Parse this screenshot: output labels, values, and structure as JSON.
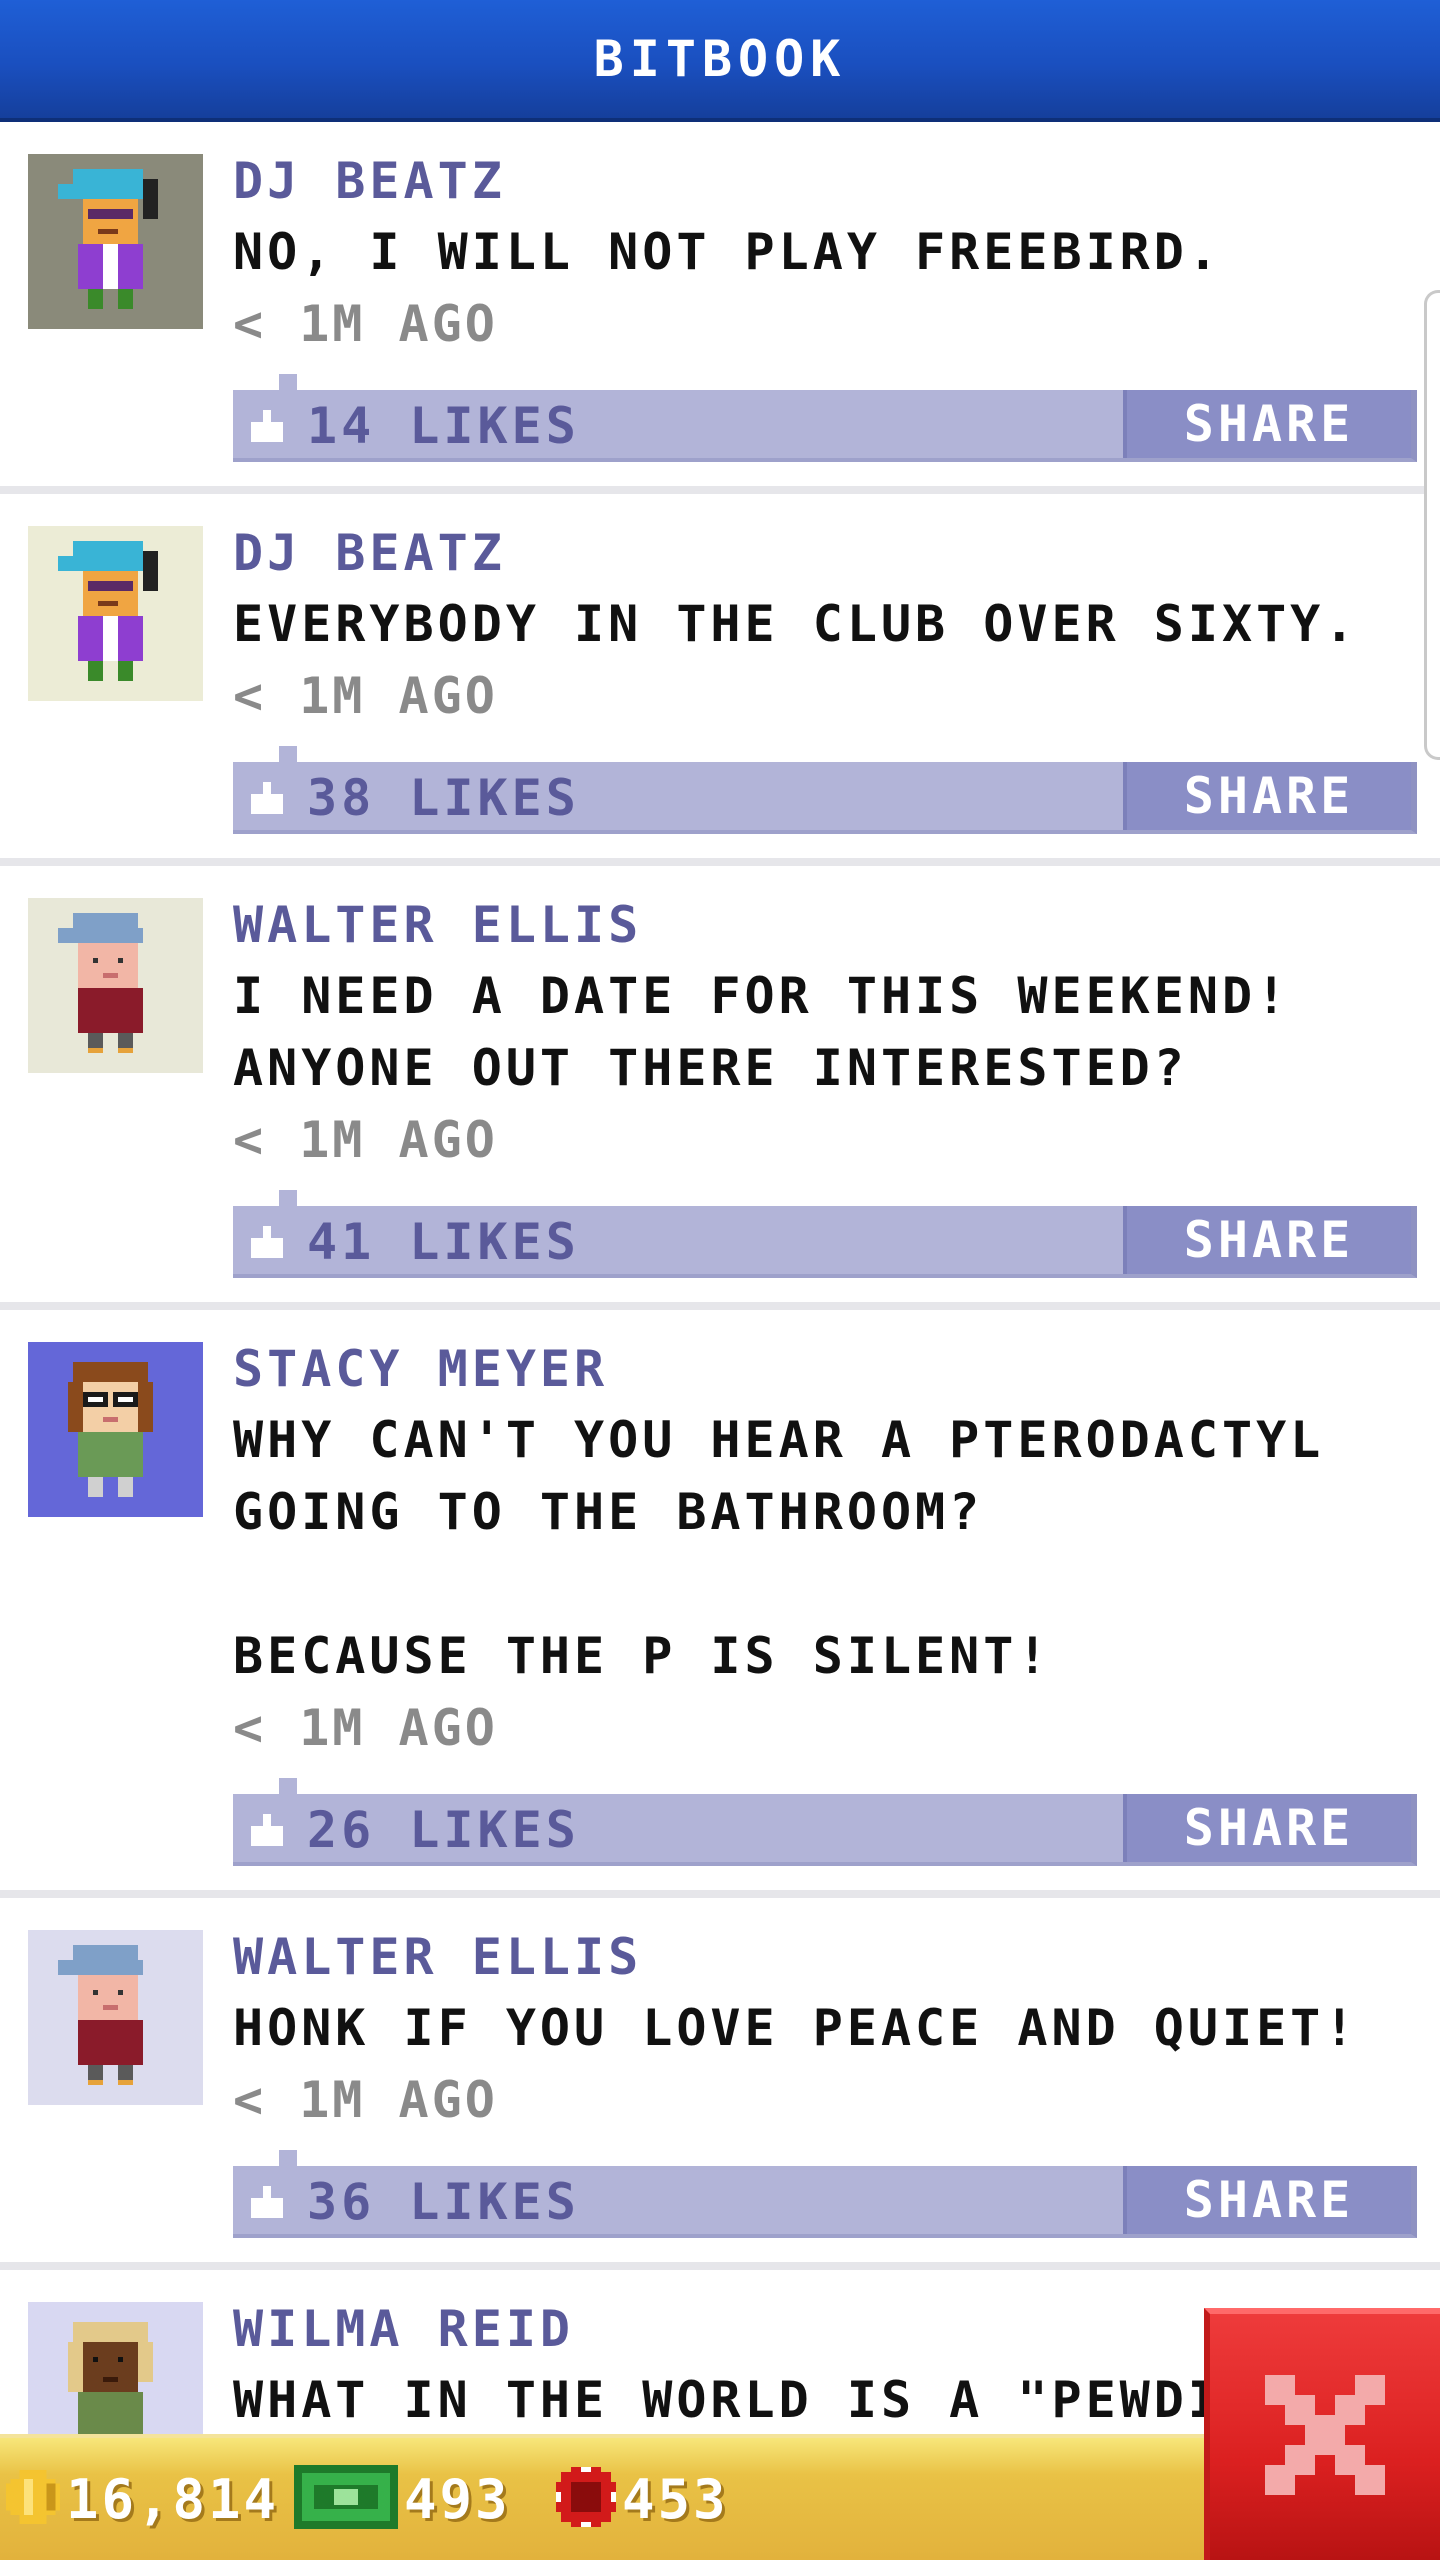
{
  "header": {
    "title": "BITBOOK"
  },
  "colors": {
    "header_blue": "#1a4fbf",
    "author_purple": "#5a5a9a",
    "like_bar": "#b2b4d8",
    "share_button": "#8a8ec6",
    "bottom_bar_gold": "#e2b23c",
    "close_red": "#db2020"
  },
  "posts": [
    {
      "author": "DJ BEATZ",
      "message": "NO, I WILL NOT PLAY FREEBIRD.",
      "time": "< 1M AGO",
      "likes": "14 LIKES",
      "share": "SHARE",
      "avatar_icon": "dj-avatar-icon"
    },
    {
      "author": "DJ BEATZ",
      "message": "EVERYBODY IN THE CLUB OVER SIXTY.",
      "time": "< 1M AGO",
      "likes": "38 LIKES",
      "share": "SHARE",
      "avatar_icon": "dj-avatar-icon"
    },
    {
      "author": "WALTER ELLIS",
      "message": "I NEED A DATE FOR THIS WEEKEND!\nANYONE OUT THERE INTERESTED?",
      "time": "< 1M AGO",
      "likes": "41 LIKES",
      "share": "SHARE",
      "avatar_icon": "old-man-avatar-icon"
    },
    {
      "author": "STACY MEYER",
      "message": "WHY CAN'T YOU HEAR A PTERODACTYL\nGOING TO THE BATHROOM?\n\nBECAUSE THE P IS SILENT!",
      "time": "< 1M AGO",
      "likes": "26 LIKES",
      "share": "SHARE",
      "avatar_icon": "glasses-woman-avatar-icon"
    },
    {
      "author": "WALTER ELLIS",
      "message": "HONK IF YOU LOVE PEACE AND QUIET!",
      "time": "< 1M AGO",
      "likes": "36 LIKES",
      "share": "SHARE",
      "avatar_icon": "old-man-avatar-icon"
    },
    {
      "author": "WILMA REID",
      "message": "WHAT IN THE WORLD IS A \"PEWDI",
      "avatar_icon": "blonde-woman-avatar-icon"
    }
  ],
  "bottom_bar": {
    "coins": "16,814",
    "cash": "493",
    "bux": "453",
    "coin_icon": "coin-icon",
    "cash_icon": "cash-icon",
    "bux_icon": "bux-icon"
  },
  "close_button": {
    "icon": "close-icon"
  }
}
